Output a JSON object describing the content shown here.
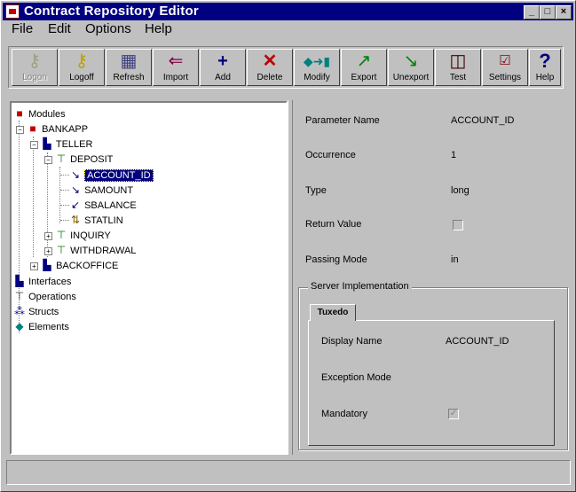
{
  "app": {
    "title": "Contract Repository Editor"
  },
  "menu": {
    "file": "File",
    "edit": "Edit",
    "options": "Options",
    "help": "Help"
  },
  "toolbar": {
    "logon": "Logon",
    "logoff": "Logoff",
    "refresh": "Refresh",
    "import": "Import",
    "add": "Add",
    "delete": "Delete",
    "modify": "Modify",
    "export": "Export",
    "unexport": "Unexport",
    "test": "Test",
    "settings": "Settings",
    "help": "Help"
  },
  "tree": {
    "modules": "Modules",
    "bankapp": "BANKAPP",
    "teller": "TELLER",
    "deposit": "DEPOSIT",
    "account_id": "ACCOUNT_ID",
    "samount": "SAMOUNT",
    "sbalance": "SBALANCE",
    "statlin": "STATLIN",
    "inquiry": "INQUIRY",
    "withdrawal": "WITHDRAWAL",
    "backoffice": "BACKOFFICE",
    "interfaces": "Interfaces",
    "operations": "Operations",
    "structs": "Structs",
    "elements": "Elements"
  },
  "details": {
    "param_name_label": "Parameter Name",
    "param_name_value": "ACCOUNT_ID",
    "occurrence_label": "Occurrence",
    "occurrence_value": "1",
    "type_label": "Type",
    "type_value": "long",
    "return_value_label": "Return Value",
    "passing_mode_label": "Passing Mode",
    "passing_mode_value": "in",
    "server_impl_label": "Server Implementation",
    "tab_tuxedo": "Tuxedo",
    "display_name_label": "Display Name",
    "display_name_value": "ACCOUNT_ID",
    "exception_mode_label": "Exception Mode",
    "mandatory_label": "Mandatory",
    "mandatory_check": "✓"
  },
  "colors": {
    "titlebar": "#000080",
    "selection": "#000080",
    "face": "#c0c0c0"
  }
}
